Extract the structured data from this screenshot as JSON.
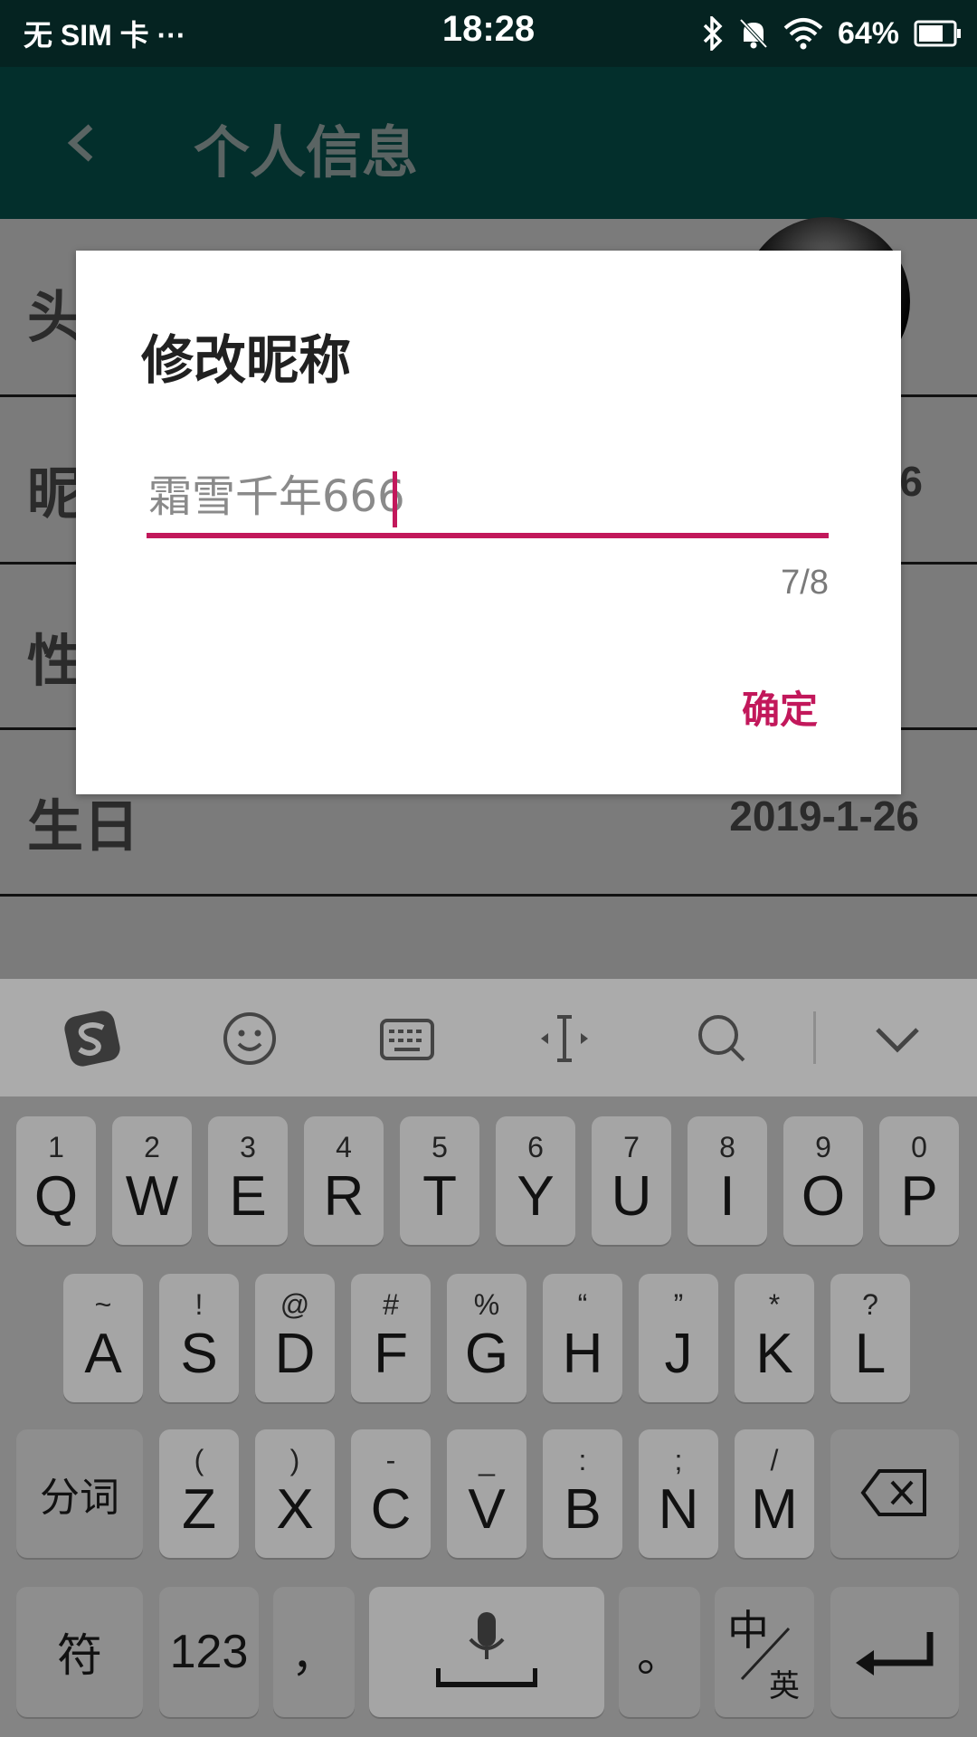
{
  "status_bar": {
    "carrier": "无 SIM 卡 ···",
    "time": "18:28",
    "battery": "64%"
  },
  "app_bar": {
    "title": "个人信息"
  },
  "rows": {
    "avatar_label": "头",
    "nickname_label": "昵",
    "nickname_value_partial": "6",
    "gender_label": "性",
    "birthday_label": "生日",
    "birthday_value": "2019-1-26"
  },
  "dialog": {
    "title": "修改昵称",
    "input_value": "霜雪千年666",
    "counter": "7/8",
    "confirm_label": "确定",
    "accent_color": "#c2185b"
  },
  "keyboard": {
    "toolbar_icons": [
      "sogou-logo-icon",
      "emoji-icon",
      "keyboard-icon",
      "cursor-move-icon",
      "search-icon",
      "collapse-icon"
    ],
    "row1": [
      {
        "main": "Q",
        "sub": "1"
      },
      {
        "main": "W",
        "sub": "2"
      },
      {
        "main": "E",
        "sub": "3"
      },
      {
        "main": "R",
        "sub": "4"
      },
      {
        "main": "T",
        "sub": "5"
      },
      {
        "main": "Y",
        "sub": "6"
      },
      {
        "main": "U",
        "sub": "7"
      },
      {
        "main": "I",
        "sub": "8"
      },
      {
        "main": "O",
        "sub": "9"
      },
      {
        "main": "P",
        "sub": "0"
      }
    ],
    "row2": [
      {
        "main": "A",
        "sub": "~"
      },
      {
        "main": "S",
        "sub": "!"
      },
      {
        "main": "D",
        "sub": "@"
      },
      {
        "main": "F",
        "sub": "#"
      },
      {
        "main": "G",
        "sub": "%"
      },
      {
        "main": "H",
        "sub": "“"
      },
      {
        "main": "J",
        "sub": "”"
      },
      {
        "main": "K",
        "sub": "*"
      },
      {
        "main": "L",
        "sub": "?"
      }
    ],
    "row3": [
      {
        "main": "Z",
        "sub": "("
      },
      {
        "main": "X",
        "sub": ")"
      },
      {
        "main": "C",
        "sub": "-"
      },
      {
        "main": "V",
        "sub": "_"
      },
      {
        "main": "B",
        "sub": ":"
      },
      {
        "main": "N",
        "sub": ";"
      },
      {
        "main": "M",
        "sub": "/"
      }
    ],
    "segment_label": "分词",
    "symbol_label": "符",
    "numbers_label": "123",
    "comma_label": "，",
    "period_label": "。",
    "lang_main": "中",
    "lang_sub": "英"
  }
}
